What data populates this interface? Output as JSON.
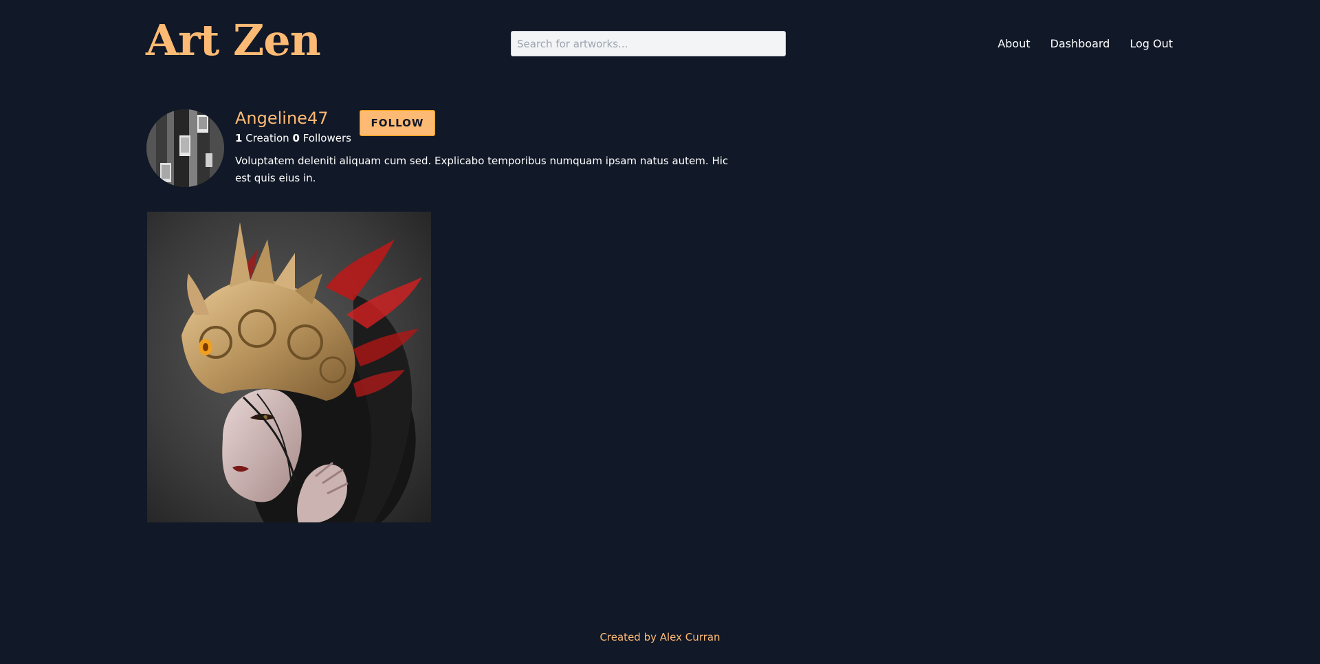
{
  "header": {
    "logo_text": "Art Zen",
    "search": {
      "placeholder": "Search for artworks...",
      "value": ""
    },
    "nav": [
      {
        "label": "About"
      },
      {
        "label": "Dashboard"
      },
      {
        "label": "Log Out"
      }
    ]
  },
  "profile": {
    "username": "Angeline47",
    "follow_label": "FOLLOW",
    "creations_count": "1",
    "creations_label": "Creation",
    "followers_count": "0",
    "followers_label": "Followers",
    "bio": "Voluptatem deleniti aliquam cum sed. Explicabo temporibus numquam ipsam natus autem. Hic est quis eius in."
  },
  "gallery": {
    "artworks": [
      {
        "alt": "Artwork: woman wearing golden ornate headdress"
      }
    ]
  },
  "footer": {
    "credit": "Created by Alex Curran"
  },
  "colors": {
    "background": "#111827",
    "accent": "#fdba74",
    "text": "#ffffff"
  }
}
